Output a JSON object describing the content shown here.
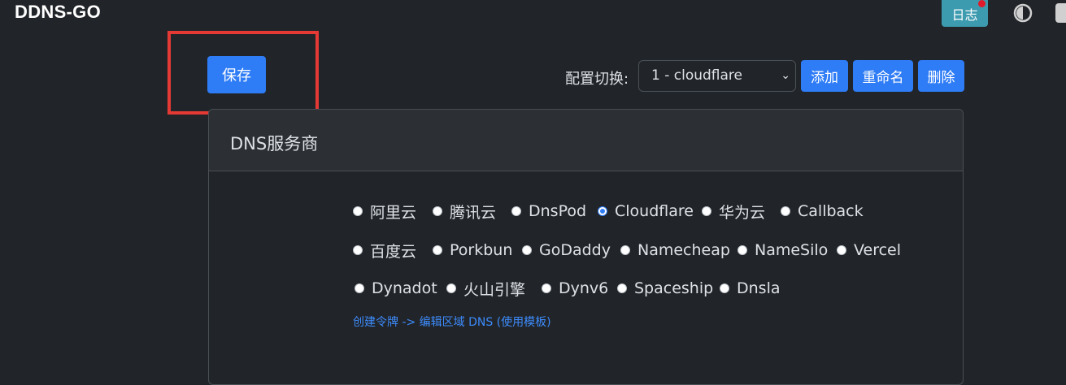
{
  "navbar": {
    "brand": "DDNS-GO",
    "log_label": "日志"
  },
  "toolbar": {
    "save_label": "保存",
    "config_label": "配置切换:",
    "config_selected": "1 - cloudflare",
    "add_label": "添加",
    "rename_label": "重命名",
    "delete_label": "删除"
  },
  "dns_card": {
    "title": "DNS服务商",
    "providers": [
      {
        "label": "阿里云",
        "checked": false
      },
      {
        "label": "腾讯云",
        "checked": false
      },
      {
        "label": "DnsPod",
        "checked": false
      },
      {
        "label": "Cloudflare",
        "checked": true
      },
      {
        "label": "华为云",
        "checked": false
      },
      {
        "label": "Callback",
        "checked": false
      },
      {
        "label": "百度云",
        "checked": false
      },
      {
        "label": "Porkbun",
        "checked": false
      },
      {
        "label": "GoDaddy",
        "checked": false
      },
      {
        "label": "Namecheap",
        "checked": false
      },
      {
        "label": "NameSilo",
        "checked": false
      },
      {
        "label": "Vercel",
        "checked": false
      },
      {
        "label": "Dynadot",
        "checked": false
      },
      {
        "label": "火山引擎",
        "checked": false
      },
      {
        "label": "Dynv6",
        "checked": false
      },
      {
        "label": "Spaceship",
        "checked": false
      },
      {
        "label": "Dnsla",
        "checked": false
      }
    ],
    "token_link": "创建令牌 -> 编辑区域 DNS (使用模板)"
  },
  "colors": {
    "background": "#212529",
    "primary": "#2e7cf6",
    "info": "#3d9bb0",
    "highlight": "#e53935",
    "link": "#3d8bfd"
  },
  "icons": {
    "theme": "half-moon-icon",
    "notification": "notification-dot-icon"
  }
}
